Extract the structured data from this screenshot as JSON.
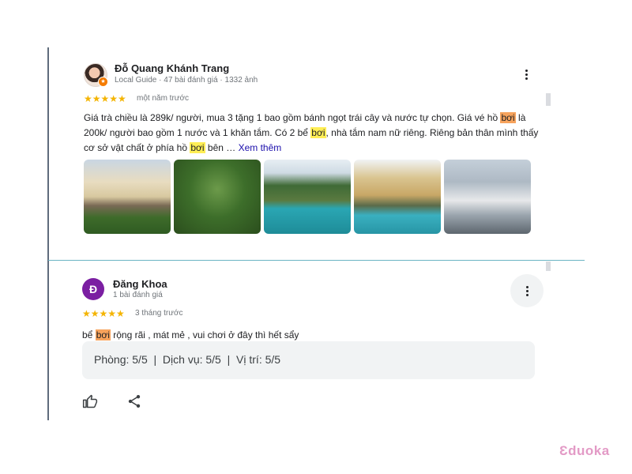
{
  "review1": {
    "author": "Đỗ Quang Khánh Trang",
    "meta": "Local Guide · 47 bài đánh giá · 1332 ảnh",
    "stars": "★★★★★",
    "rating": 5,
    "time": "một năm trước",
    "text_parts": [
      "Giá trà chiều là 289k/ người, mua 3 tặng 1 bao gồm bánh ngọt trái cây và nước tự chọn. Giá vé hồ ",
      "bơi",
      " là 200k/ người bao gồm 1 nước và 1 khăn tắm. Có 2 bể ",
      "bơi",
      ", nhà tắm nam nữ riêng. Riêng bản thân mình thấy cơ sở vật chất ở phía hồ ",
      "bơi",
      " bên … "
    ],
    "more_label": "Xem thêm"
  },
  "review2": {
    "avatar_letter": "Đ",
    "author": "Đăng Khoa",
    "meta": "1 bài đánh giá",
    "stars": "★★★★★",
    "rating": 5,
    "time": "3 tháng trước",
    "text_parts": [
      "bể ",
      "bơi",
      " rộng rãi , mát mẻ , vui chơi ở đây thì hết sẩy"
    ],
    "ratings_line": "Phòng: 5/5  |  Dịch vụ: 5/5  |  Vị trí: 5/5"
  },
  "icons": {
    "more": "more-vert-icon",
    "like": "thumb-up-icon",
    "share": "share-icon",
    "guide": "local-guide-badge-icon"
  },
  "colors": {
    "highlight_orange": "#f7a35c",
    "highlight_yellow": "#ffee55",
    "star": "#f4b400",
    "avatar_purple": "#7b1fa2",
    "link": "#1a0dab",
    "watermark": "#e39ac6"
  },
  "watermark": "Ɛduoka"
}
